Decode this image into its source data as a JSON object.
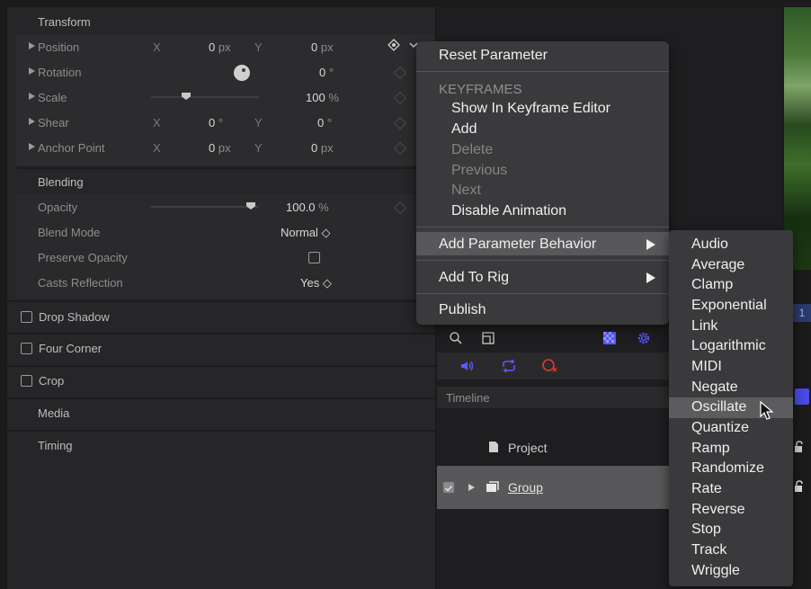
{
  "inspector": {
    "transform": {
      "title": "Transform",
      "rows": [
        {
          "label": "Position",
          "axis1": "X",
          "v1": "0",
          "u1": "px",
          "axis2": "Y",
          "v2": "0",
          "u2": "px"
        },
        {
          "label": "Rotation",
          "v2": "0",
          "u2": "°"
        },
        {
          "label": "Scale",
          "v2": "100",
          "u2": "%"
        },
        {
          "label": "Shear",
          "axis1": "X",
          "v1": "0",
          "u1": "°",
          "axis2": "Y",
          "v2": "0",
          "u2": "°"
        },
        {
          "label": "Anchor Point",
          "axis1": "X",
          "v1": "0",
          "u1": "px",
          "axis2": "Y",
          "v2": "0",
          "u2": "px"
        }
      ]
    },
    "blending": {
      "title": "Blending",
      "opacity_label": "Opacity",
      "opacity_value": "100.0",
      "opacity_unit": "%",
      "opacity_level": 1.0,
      "blend_mode_label": "Blend Mode",
      "blend_mode_value": "Normal ◇",
      "preserve_opacity_label": "Preserve Opacity",
      "casts_reflection_label": "Casts Reflection",
      "casts_reflection_value": "Yes ◇"
    },
    "sections": {
      "drop_shadow": "Drop Shadow",
      "four_corner": "Four Corner",
      "crop": "Crop",
      "media": "Media",
      "timing": "Timing"
    }
  },
  "context_menu": {
    "reset": "Reset Parameter",
    "keyframes_header": "KEYFRAMES",
    "show_in_keyframe_editor": "Show In Keyframe Editor",
    "add": "Add",
    "delete": "Delete",
    "previous": "Previous",
    "next": "Next",
    "disable_animation": "Disable Animation",
    "add_parameter_behavior": "Add Parameter Behavior",
    "add_to_rig": "Add To Rig",
    "publish": "Publish"
  },
  "submenu": {
    "items": [
      "Audio",
      "Average",
      "Clamp",
      "Exponential",
      "Link",
      "Logarithmic",
      "MIDI",
      "Negate",
      "Oscillate",
      "Quantize",
      "Ramp",
      "Randomize",
      "Rate",
      "Reverse",
      "Stop",
      "Track",
      "Wriggle"
    ],
    "highlighted": "Oscillate"
  },
  "timeline": {
    "label": "Timeline",
    "project_label": "Project",
    "group_label": "Group",
    "marker": "1"
  },
  "colors": {
    "accent_blue": "#5a5aff",
    "record_red": "#e03a2a",
    "menu_bg": "#3a3a3c",
    "highlight": "#58585b"
  }
}
